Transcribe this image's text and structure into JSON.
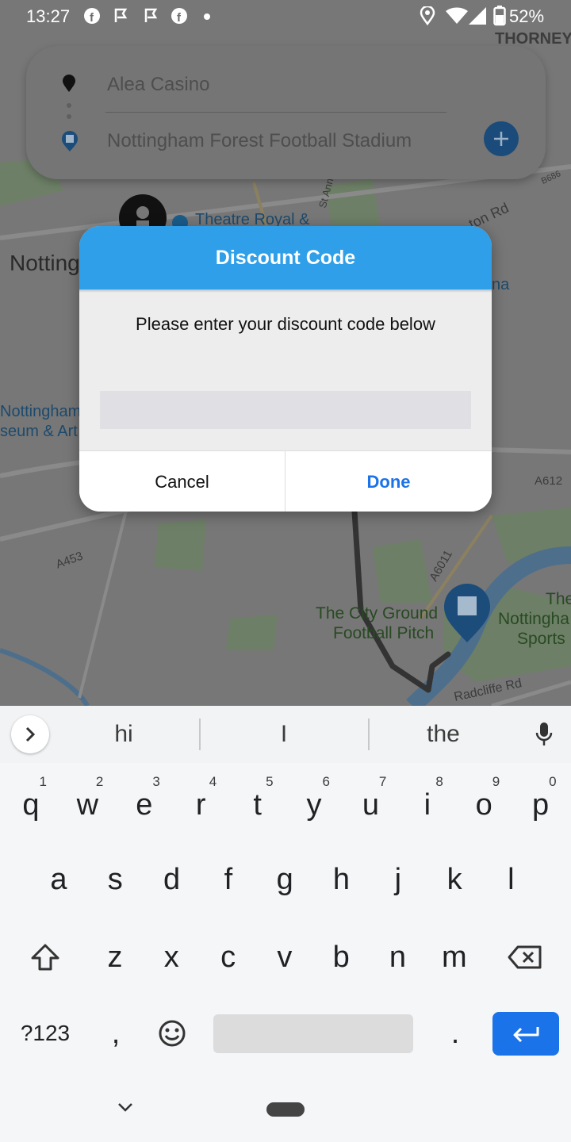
{
  "status_bar": {
    "time": "13:27",
    "battery": "52%",
    "icons": [
      "facebook-icon",
      "notification-icon",
      "notification-icon",
      "facebook-icon",
      "dot-icon",
      "location-icon",
      "wifi-icon",
      "signal-icon",
      "battery-icon"
    ]
  },
  "map": {
    "labels": {
      "thorney": "THORNEY",
      "notting": "Notting",
      "theatre": "Theatre Royal &",
      "nottingham_museum_1": "Nottingham",
      "nottingham_museum_2": "seum & Art",
      "st_ann": "St Ann",
      "road_b686": "B686",
      "ton_rd": "ton Rd",
      "na": "na",
      "a612": "A612",
      "a453": "A453",
      "a6011": "A6011",
      "city_ground_1": "The City Ground",
      "city_ground_2": "Football Pitch",
      "the_sports_1": "The",
      "the_sports_2": "Nottingha",
      "the_sports_3": "Sports",
      "radcliffe": "Radcliffe Rd"
    }
  },
  "route": {
    "origin": "Alea Casino",
    "destination": "Nottingham Forest Football Stadium",
    "add_button_icon": "plus-icon"
  },
  "dialog": {
    "title": "Discount Code",
    "message": "Please enter your discount code below",
    "input_value": "",
    "cancel_label": "Cancel",
    "done_label": "Done"
  },
  "keyboard": {
    "suggestions": [
      "hi",
      "I",
      "the"
    ],
    "row1": [
      {
        "k": "q",
        "n": "1"
      },
      {
        "k": "w",
        "n": "2"
      },
      {
        "k": "e",
        "n": "3"
      },
      {
        "k": "r",
        "n": "4"
      },
      {
        "k": "t",
        "n": "5"
      },
      {
        "k": "y",
        "n": "6"
      },
      {
        "k": "u",
        "n": "7"
      },
      {
        "k": "i",
        "n": "8"
      },
      {
        "k": "o",
        "n": "9"
      },
      {
        "k": "p",
        "n": "0"
      }
    ],
    "row2": [
      "a",
      "s",
      "d",
      "f",
      "g",
      "h",
      "j",
      "k",
      "l"
    ],
    "row3": [
      "z",
      "x",
      "c",
      "v",
      "b",
      "n",
      "m"
    ],
    "symbols_label": "?123",
    "comma": ",",
    "period": "."
  },
  "colors": {
    "accent": "#2e9fe8",
    "done_text": "#1a73e8",
    "enter_key": "#1a73e8"
  }
}
